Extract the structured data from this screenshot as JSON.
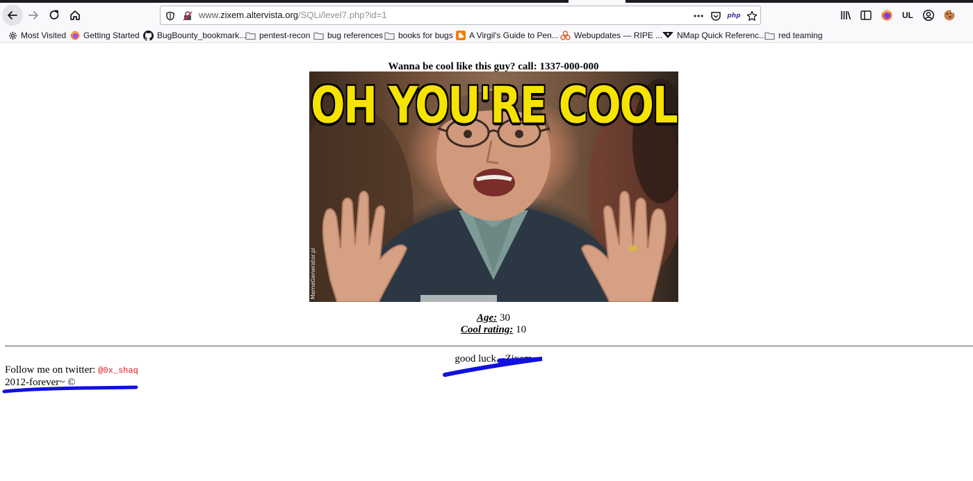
{
  "browser": {
    "url_prefix": "www.",
    "url_host": "zixem.altervista.org",
    "url_path": "/SQLi/level7.php?id=1",
    "php_badge": "php",
    "account_initials": "UL"
  },
  "bookmarks": [
    {
      "label": "Most Visited",
      "icon": "gear-icon"
    },
    {
      "label": "Getting Started",
      "icon": "firefox-icon"
    },
    {
      "label": "BugBounty_bookmark...",
      "icon": "github-icon"
    },
    {
      "label": "pentest-recon",
      "icon": "folder-icon"
    },
    {
      "label": "bug references",
      "icon": "folder-icon"
    },
    {
      "label": "books for bugs",
      "icon": "folder-icon"
    },
    {
      "label": "A Virgil's Guide to Pen...",
      "icon": "blogger-icon"
    },
    {
      "label": "Webupdates — RIPE ...",
      "icon": "ripe-icon"
    },
    {
      "label": "NMap Quick Referenc...",
      "icon": "nmap-icon"
    },
    {
      "label": "red teaming",
      "icon": "folder-icon"
    }
  ],
  "page": {
    "headline": "Wanna be cool like this guy? call: 1337-000-000",
    "meme_caption": "OH YOU'RE COOL",
    "meme_watermark": "MemeGenerator.pl",
    "age_label": "Age:",
    "age_value": " 30",
    "rating_label": "Cool rating:",
    "rating_value": " 10",
    "good_luck": "good luck. -Zixem",
    "follow_text": "Follow me on twitter: ",
    "twitter_handle": "@0x_shaq",
    "copyright": "2012-forever~ ©"
  },
  "colors": {
    "meme_text": "#f6e300",
    "handle": "#e8141b",
    "scribble": "#1010e0"
  }
}
